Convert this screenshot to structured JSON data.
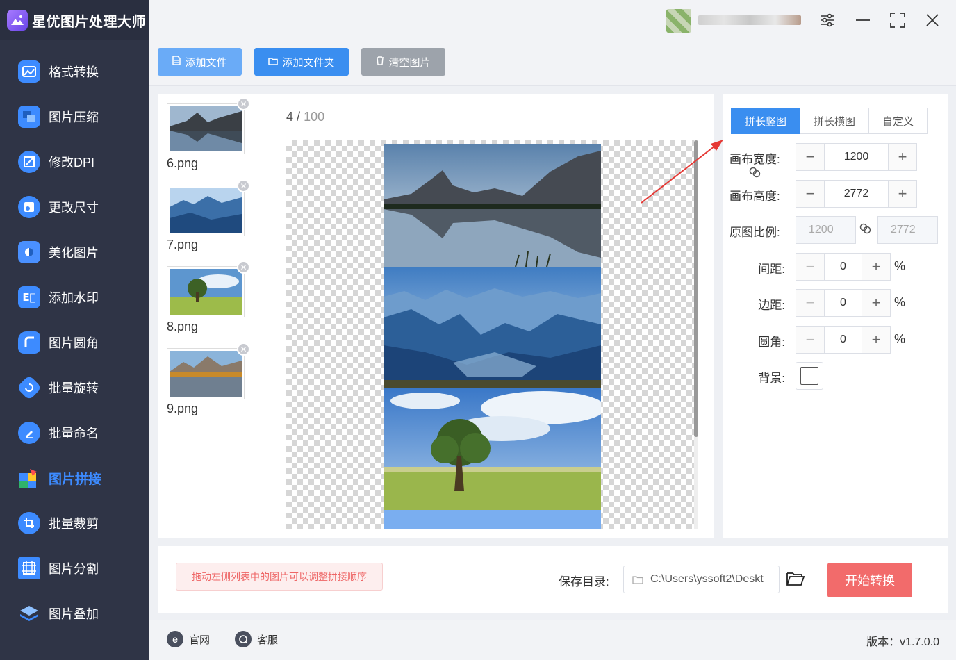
{
  "app": {
    "title": "星优图片处理大师"
  },
  "sidebar": {
    "items": [
      {
        "label": "格式转换",
        "icon": "image-convert-icon",
        "color": "#3d8bff"
      },
      {
        "label": "图片压缩",
        "icon": "image-compress-icon",
        "color": "#3d8bff"
      },
      {
        "label": "修改DPI",
        "icon": "dpi-icon",
        "color": "#3d8bff"
      },
      {
        "label": "更改尺寸",
        "icon": "resize-icon",
        "color": "#3d8bff"
      },
      {
        "label": "美化图片",
        "icon": "beautify-icon",
        "color": "#3d8bff"
      },
      {
        "label": "添加水印",
        "icon": "watermark-icon",
        "color": "#3d8bff"
      },
      {
        "label": "图片圆角",
        "icon": "rounded-corner-icon",
        "color": "#3d8bff"
      },
      {
        "label": "批量旋转",
        "icon": "rotate-icon",
        "color": "#3d8bff"
      },
      {
        "label": "批量命名",
        "icon": "rename-icon",
        "color": "#3d8bff"
      },
      {
        "label": "图片拼接",
        "icon": "puzzle-icon",
        "color": "#3d8bff",
        "active": true
      },
      {
        "label": "批量裁剪",
        "icon": "crop-icon",
        "color": "#3d8bff"
      },
      {
        "label": "图片分割",
        "icon": "split-icon",
        "color": "#3d8bff"
      },
      {
        "label": "图片叠加",
        "icon": "layers-icon",
        "color": "#3d8bff"
      }
    ]
  },
  "toolbar": {
    "add_file": "添加文件",
    "add_folder": "添加文件夹",
    "clear_images": "清空图片"
  },
  "files": {
    "items": [
      {
        "name": "6.png"
      },
      {
        "name": "7.png"
      },
      {
        "name": "8.png"
      },
      {
        "name": "9.png"
      }
    ]
  },
  "preview": {
    "count": "4",
    "separator": "/",
    "total": "100"
  },
  "settings": {
    "tabs": [
      "拼长竖图",
      "拼长横图",
      "自定义"
    ],
    "active_tab": "拼长竖图",
    "canvas_width_label": "画布宽度:",
    "canvas_width": "1200",
    "canvas_height_label": "画布高度:",
    "canvas_height": "2772",
    "ratio_label": "原图比例:",
    "ratio_width": "1200",
    "ratio_height": "2772",
    "spacing_label": "间距:",
    "spacing": "0",
    "margin_label": "边距:",
    "margin": "0",
    "radius_label": "圆角:",
    "radius": "0",
    "percent": "%",
    "background_label": "背景:"
  },
  "bottom": {
    "hint": "拖动左侧列表中的图片可以调整拼接顺序",
    "save_label": "保存目录:",
    "save_path": "C:\\Users\\yssoft2\\Deskt",
    "start_button": "开始转换"
  },
  "footer": {
    "website": "官网",
    "support": "客服",
    "version": "版本：v1.7.0.0"
  },
  "colors": {
    "accent": "#3a8ef0",
    "start": "#f26b6b",
    "sidebar": "#2f3446"
  }
}
